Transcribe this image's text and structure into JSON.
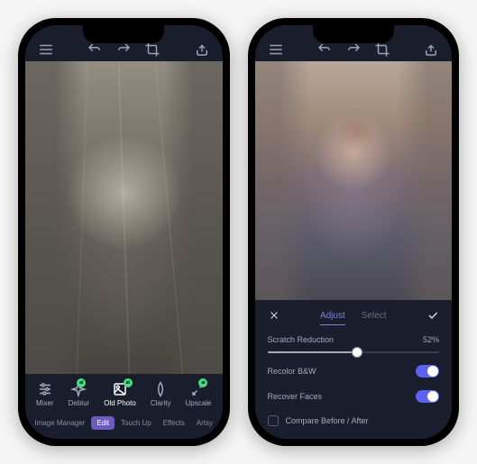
{
  "left": {
    "tools": [
      {
        "label": "Mixer",
        "ai": false
      },
      {
        "label": "Deblur",
        "ai": true
      },
      {
        "label": "Old Photo",
        "ai": true,
        "selected": true
      },
      {
        "label": "Clarity",
        "ai": false
      },
      {
        "label": "Upscale",
        "ai": true
      }
    ],
    "tabs": [
      {
        "label": "Image Manager"
      },
      {
        "label": "Edit",
        "active": true
      },
      {
        "label": "Touch Up"
      },
      {
        "label": "Effects"
      },
      {
        "label": "Artsy"
      }
    ]
  },
  "right": {
    "panel_tabs": [
      {
        "label": "Adjust",
        "active": true
      },
      {
        "label": "Select"
      }
    ],
    "slider": {
      "label": "Scratch Reduction",
      "value": "52%"
    },
    "toggles": [
      {
        "label": "Recolor B&W",
        "on": true
      },
      {
        "label": "Recover Faces",
        "on": true
      }
    ],
    "checkbox": {
      "label": "Compare Before / After",
      "checked": false
    }
  }
}
